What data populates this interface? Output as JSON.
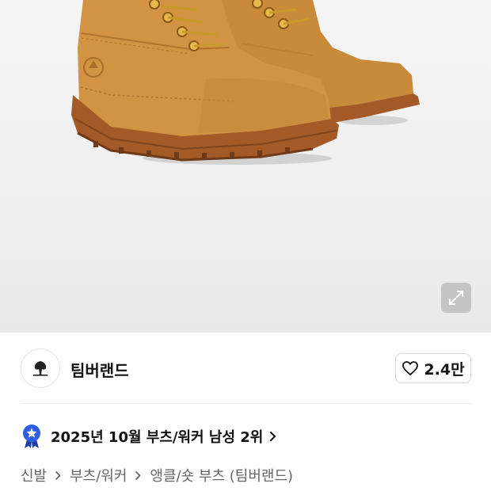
{
  "product": {
    "image_alt_icon": "timberland-boot-image"
  },
  "expand": {
    "icon": "expand-icon"
  },
  "brand": {
    "name": "팀버랜드",
    "logo_icon": "timberland-tree-logo"
  },
  "like": {
    "count": "2.4만",
    "icon": "heart-outline-icon"
  },
  "ranking": {
    "text": "2025년 10월 부츠/워커 남성 2위",
    "badge_icon": "star-medal-icon",
    "badge_color": "#2f5fe0"
  },
  "breadcrumb": {
    "items": [
      "신발",
      "부츠/워커",
      "앵클/숏 부츠 (팀버랜드)"
    ]
  },
  "colors": {
    "boot_leather": "#c98a3a",
    "sole": "#a45a27"
  }
}
